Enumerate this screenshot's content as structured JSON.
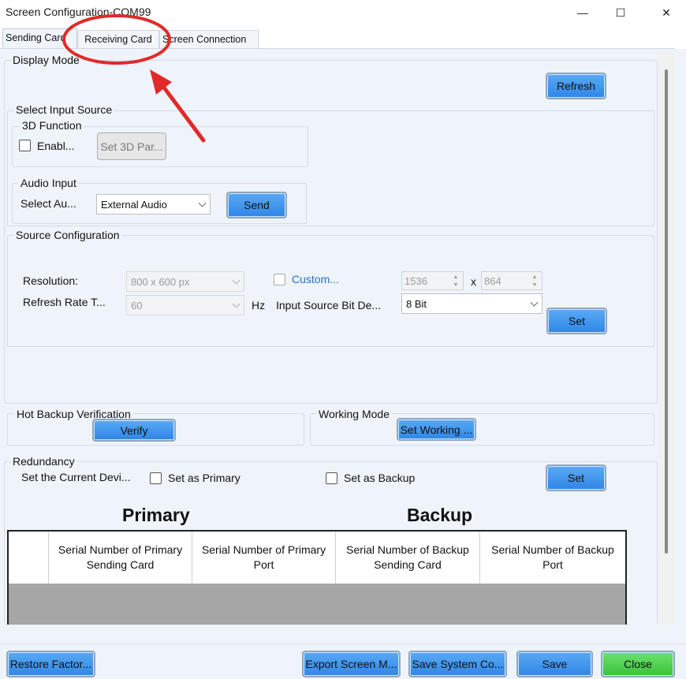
{
  "window": {
    "title": "Screen Configuration-COM99",
    "minimize": "—",
    "maximize": "☐",
    "close": "✕"
  },
  "tabs": [
    {
      "label": "Sending Card"
    },
    {
      "label": "Receiving Card"
    },
    {
      "label": "Screen Connection"
    }
  ],
  "display_mode": {
    "title": "Display Mode",
    "refresh_label": "Refresh"
  },
  "input_source": {
    "title": "Select Input Source",
    "function_3d": {
      "title": "3D Function",
      "enable_label": "Enabl...",
      "set_params_label": "Set 3D Par..."
    },
    "audio": {
      "title": "Audio Input",
      "select_label": "Select Au...",
      "selected": "External Audio",
      "send_label": "Send"
    }
  },
  "source_config": {
    "title": "Source Configuration",
    "resolution_label": "Resolution:",
    "resolution_value": "800 x 600 px",
    "custom_label": "Custom...",
    "width_value": "1536",
    "x_label": "x",
    "height_value": "864",
    "refresh_label": "Refresh Rate T...",
    "refresh_value": "60",
    "hz_label": "Hz",
    "bit_depth_label": "Input Source Bit De...",
    "bit_depth_value": "8 Bit",
    "set_label": "Set"
  },
  "hot_backup": {
    "title": "Hot Backup Verification",
    "verify_label": "Verify"
  },
  "working_mode": {
    "title": "Working Mode",
    "set_label": "Set Working ..."
  },
  "redundancy": {
    "title": "Redundancy",
    "current_label": "Set the Current Devi...",
    "primary_label": "Set as Primary",
    "backup_label": "Set as Backup",
    "set_label": "Set",
    "primary_header": "Primary",
    "backup_header": "Backup",
    "columns": [
      "Serial Number of Primary Sending Card",
      "Serial Number of Primary Port",
      "Serial Number of Backup Sending Card",
      "Serial Number of Backup Port"
    ]
  },
  "footer": {
    "restore_label": "Restore Factor...",
    "export_label": "Export Screen M...",
    "save_system_label": "Save System Co...",
    "save_label": "Save",
    "close_label": "Close"
  },
  "colors": {
    "background": "#eef4fa",
    "button_blue": "#3a8fe8",
    "close_green": "#4dcf4d",
    "annotation_red": "#e02a2a"
  }
}
